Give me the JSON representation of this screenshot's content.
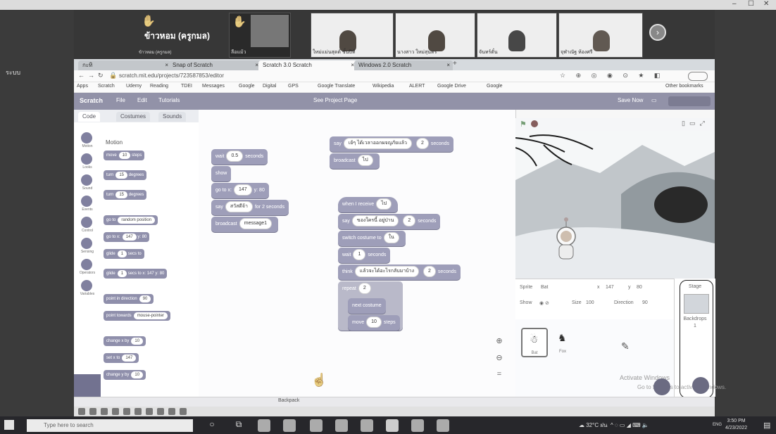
{
  "meeting": {
    "left_label": "ระบบ",
    "tiles": [
      {
        "caption": "ข้าวหอม (ครูกมล)",
        "name": "ข้าวหอม (ครูกมล)"
      },
      {
        "caption": "ลือแม้ว"
      },
      {
        "caption": "ใหม่แม่นสุดต์ ชั้นปีที่"
      },
      {
        "caption": "นางสาว ใหม่สุนทร"
      },
      {
        "caption": "จันทร์ตั๋น"
      },
      {
        "caption": "จุฬาณัฐ ห้องศรี"
      }
    ],
    "window_controls": [
      "–",
      "☐",
      "✕"
    ]
  },
  "browser": {
    "tabs": [
      {
        "label": "กะทิ"
      },
      {
        "label": "Snap of Scratch"
      },
      {
        "label": "Scratch 3.0 Scratch"
      },
      {
        "label": "Windows 2.0 Scratch"
      }
    ],
    "url": "scratch.mit.edu/projects/723587853/editor",
    "bookmarks": [
      "Apps",
      "Scratch",
      "Udemy",
      "Reading",
      "TDEI",
      "Messages",
      "Google",
      "Digital",
      "GPS",
      "Google Translate",
      "Wikipedia",
      "ALERT",
      "Google Drive",
      "Google",
      "Other bookmarks"
    ]
  },
  "scratch": {
    "menu": [
      "Scratch",
      "File",
      "Edit",
      "Tutorials",
      "See Project Page",
      "Save Now"
    ],
    "tabs": [
      "Code",
      "Costumes",
      "Sounds"
    ],
    "category_heading": "Motion",
    "categories": [
      "Motion",
      "Looks",
      "Sound",
      "Events",
      "Control",
      "Sensing",
      "Operators",
      "Variables",
      "My Blocks"
    ],
    "palette_blocks": [
      {
        "label": "move",
        "value": "10",
        "unit": "steps"
      },
      {
        "label": "turn",
        "value": "15",
        "unit": "degrees"
      },
      {
        "label": "turn",
        "value": "15",
        "unit": "degrees"
      },
      {
        "label": "go to",
        "value": "random position"
      },
      {
        "label": "go to x:",
        "value": "147",
        "unit": "y: 80"
      },
      {
        "label": "glide",
        "value": "1",
        "unit": "secs to"
      },
      {
        "label": "glide",
        "value": "1",
        "unit": "secs to x: 147 y: 80"
      },
      {
        "label": "point in direction",
        "value": "90"
      },
      {
        "label": "point towards",
        "value": "mouse-pointer"
      },
      {
        "label": "change x by",
        "value": "10"
      },
      {
        "label": "set x to",
        "value": "147"
      },
      {
        "label": "change y by",
        "value": "10"
      }
    ],
    "script1": [
      {
        "label": "wait",
        "value": "0.5",
        "unit": "seconds"
      },
      {
        "label": "show"
      },
      {
        "label": "go to x:",
        "value": "147",
        "unit": "y: 80"
      },
      {
        "label": "say",
        "value": "สวัสดีจ้า",
        "unit": "for 2 seconds"
      },
      {
        "label": "broadcast",
        "value": "message1"
      }
    ],
    "script2": [
      {
        "label": "say",
        "value": "เย้ๆ ได้เวลาออกผจญภัยแล้ว",
        "value2": "2",
        "unit": "seconds"
      },
      {
        "label": "broadcast",
        "value": "ไป"
      }
    ],
    "script3": [
      {
        "label": "when I receive",
        "value": "ไป"
      },
      {
        "label": "say",
        "value": "ของใครนี้ อยู่ป่าน",
        "value2": "2",
        "unit": "seconds"
      },
      {
        "label": "switch costume to",
        "value": "ใน"
      },
      {
        "label": "wait",
        "value": "1",
        "unit": "seconds"
      },
      {
        "label": "think",
        "value": "แล้วจะได้อะไรกลับมาบ้าง",
        "value2": "2",
        "unit": "seconds"
      },
      {
        "label": "repeat",
        "value": "2"
      },
      {
        "label": "next costume"
      },
      {
        "label": "move",
        "value": "10",
        "unit": "steps"
      }
    ],
    "sprite_info": {
      "sprite_label": "Sprite",
      "sprite_name": "Bat",
      "x_label": "x",
      "x_value": "147",
      "y_label": "y",
      "y_value": "80",
      "show_label": "Show",
      "size_label": "Size",
      "size_value": "100",
      "direction_label": "Direction",
      "direction_value": "90"
    },
    "sprites": [
      {
        "name": "Bat"
      },
      {
        "name": "Fox"
      }
    ],
    "stage_panel": {
      "title": "Stage",
      "backdrops_label": "Backdrops",
      "backdrops_count": "1"
    },
    "backpack": "Backpack",
    "watermark1": "Activate Windows",
    "watermark2": "Go to Settings to activate Windows."
  },
  "taskbar": {
    "search_placeholder": "Type here to search",
    "weather": "32°C  ฝน",
    "lang": "ENG",
    "time": "3:50 PM",
    "date": "4/23/2022"
  }
}
